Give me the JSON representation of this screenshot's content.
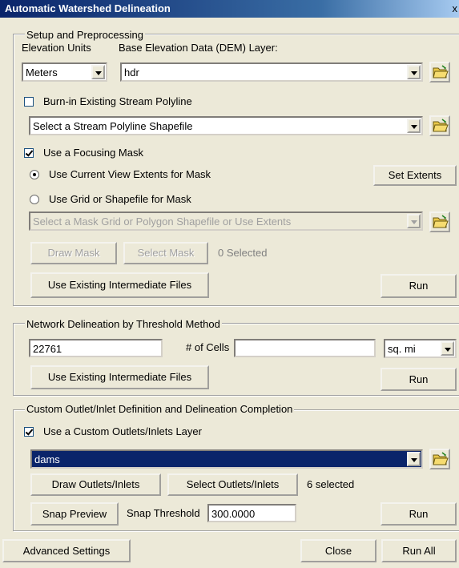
{
  "window": {
    "title": "Automatic Watershed Delineation",
    "close_glyph": "x"
  },
  "setup": {
    "group_label": "Setup and Preprocessing",
    "elev_units_label": "Elevation Units",
    "dem_label": "Base Elevation Data (DEM) Layer:",
    "elev_units_value": "Meters",
    "dem_value": "hdr",
    "burn_in_label": "Burn-in Existing Stream Polyline",
    "burn_in_checked": false,
    "stream_select_value": "Select a Stream Polyline Shapefile",
    "focus_mask_label": "Use a Focusing Mask",
    "focus_mask_checked": true,
    "use_view_extents_label": "Use Current View Extents for Mask",
    "set_extents_label": "Set Extents",
    "use_grid_label": "Use Grid or Shapefile for Mask",
    "mask_select_value": "Select a Mask Grid or Polygon Shapefile or Use Extents",
    "draw_mask_label": "Draw Mask",
    "select_mask_label": "Select Mask",
    "selected_count": "0 Selected",
    "use_existing_label": "Use Existing Intermediate Files",
    "run_label": "Run"
  },
  "network": {
    "group_label": "Network Delineation by Threshold Method",
    "threshold_value": "22761",
    "cells_label": "# of Cells",
    "area_value": "",
    "unit_value": "sq. mi",
    "use_existing_label": "Use Existing Intermediate Files",
    "run_label": "Run"
  },
  "outlet": {
    "group_label": "Custom Outlet/Inlet Definition and Delineation Completion",
    "custom_layer_label": "Use a Custom Outlets/Inlets Layer",
    "custom_layer_checked": true,
    "layer_value": "dams",
    "draw_label": "Draw Outlets/Inlets",
    "select_label": "Select Outlets/Inlets",
    "selected_count": "6 selected",
    "snap_preview_label": "Snap Preview",
    "snap_threshold_label": "Snap Threshold",
    "snap_threshold_value": "300.0000",
    "run_label": "Run"
  },
  "footer": {
    "advanced_label": "Advanced Settings",
    "close_label": "Close",
    "run_all_label": "Run All"
  },
  "colors": {
    "face": "#ece9d8",
    "title_start": "#0a246a",
    "title_end": "#a6caf0",
    "selection": "#0a246a"
  }
}
